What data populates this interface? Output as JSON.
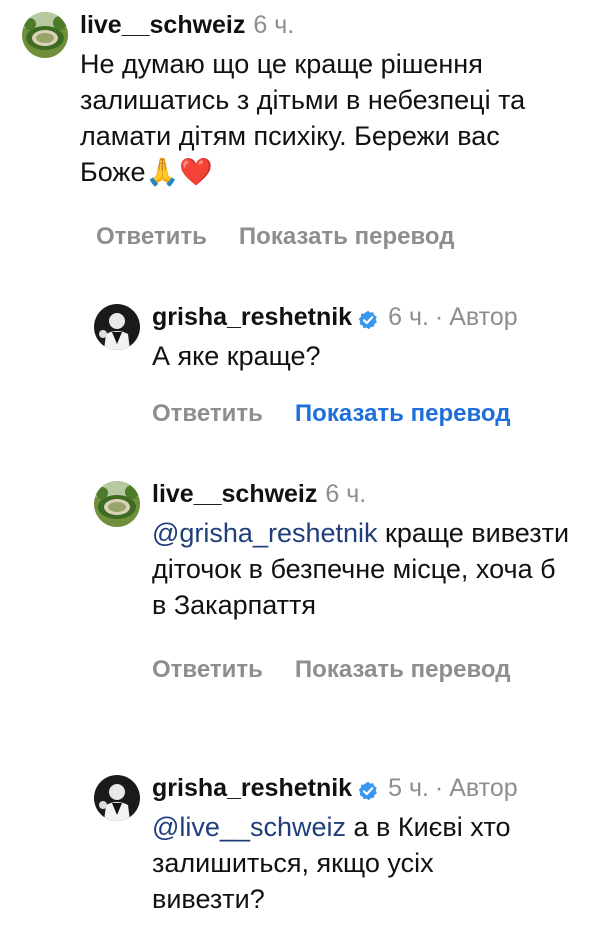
{
  "comments": [
    {
      "username": "live__schweiz",
      "time": "6 ч.",
      "text": "Не думаю що це краще рішення залишатись з дітьми в небезпеці та ламати дітям психіку. Бережи вас Боже🙏❤️",
      "reply_label": "Ответить",
      "translate_label": "Показать перевод"
    },
    {
      "username": "grisha_reshetnik",
      "time": "6 ч.",
      "separator": "·",
      "author_label": "Автор",
      "text": "А яке краще?",
      "reply_label": "Ответить",
      "translate_label": "Показать перевод"
    },
    {
      "username": "live__schweiz",
      "time": "6 ч.",
      "mention": "@grisha_reshetnik",
      "text": " краще вивезти діточок в безпечне місце, хоча б в Закарпаття",
      "reply_label": "Ответить",
      "translate_label": "Показать перевод"
    },
    {
      "username": "grisha_reshetnik",
      "time": "5 ч.",
      "separator": "·",
      "author_label": "Автор",
      "mention": "@live__schweiz",
      "text": " а в Києві хто залишиться, якщо усіх вивезти?"
    }
  ],
  "colors": {
    "muted": "#8e8e8e",
    "link_blue": "#1e6fd9",
    "mention": "#1f3e7a",
    "verified": "#3897f0"
  },
  "icons": {
    "verified": "verified-badge-icon"
  }
}
